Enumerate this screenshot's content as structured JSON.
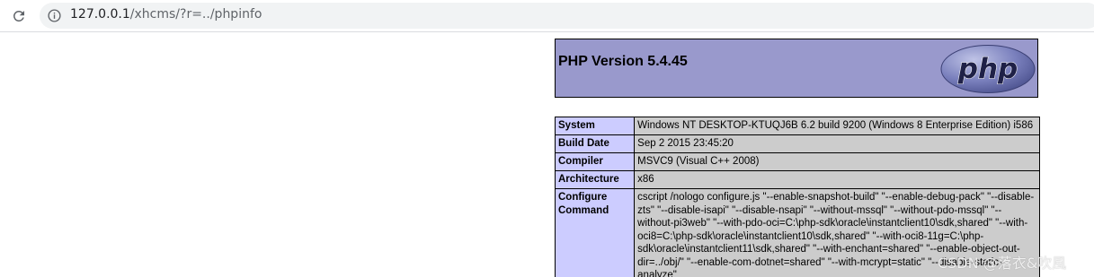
{
  "browser": {
    "url_host": "127.0.0.1",
    "url_path": "/xhcms/?r=../phpinfo"
  },
  "php": {
    "version_title": "PHP Version 5.4.45",
    "logo_text": "php"
  },
  "info_rows": [
    {
      "label": "System",
      "value": "Windows NT DESKTOP-KTUQJ6B 6.2 build 9200 (Windows 8 Enterprise Edition) i586"
    },
    {
      "label": "Build Date",
      "value": "Sep 2 2015 23:45:20"
    },
    {
      "label": "Compiler",
      "value": "MSVC9 (Visual C++ 2008)"
    },
    {
      "label": "Architecture",
      "value": "x86"
    },
    {
      "label": "Configure Command",
      "value": "cscript /nologo configure.js \"--enable-snapshot-build\" \"--enable-debug-pack\" \"--disable-zts\" \"--disable-isapi\" \"--disable-nsapi\" \"--without-mssql\" \"--without-pdo-mssql\" \"--without-pi3web\" \"--with-pdo-oci=C:\\php-sdk\\oracle\\instantclient10\\sdk,shared\" \"--with-oci8=C:\\php-sdk\\oracle\\instantclient10\\sdk,shared\" \"--with-oci8-11g=C:\\php-sdk\\oracle\\instantclient11\\sdk,shared\" \"--with-enchant=shared\" \"--enable-object-out-dir=../obj/\" \"--enable-com-dotnet=shared\" \"--with-mcrypt=static\" \"--disable-static-analyze\""
    }
  ],
  "watermark": "CSDN @落衣&吹風"
}
